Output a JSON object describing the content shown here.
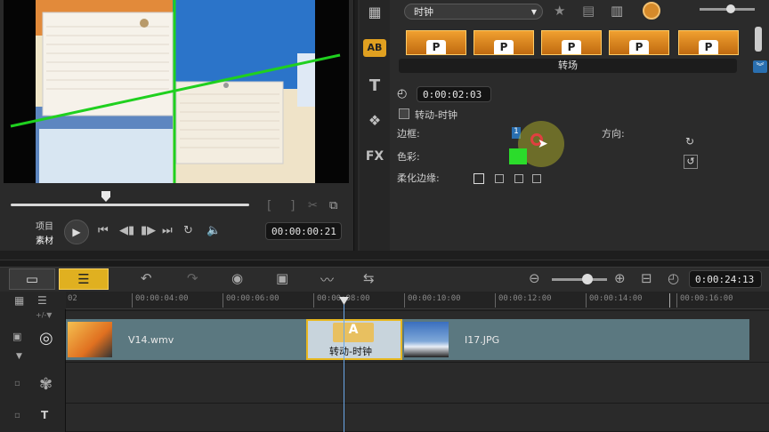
{
  "preview": {
    "mode_project": "项目",
    "mode_clip": "素材",
    "timecode": "00:00:00:21",
    "mark_in": "[",
    "mark_out": "]"
  },
  "options": {
    "dropdown_value": "时钟",
    "duration": "0:00:02:03",
    "transition_name": "转动-时钟",
    "title_bar": "转场",
    "border_label": "边框:",
    "border_value": "1",
    "direction_label": "方向:",
    "color_label": "色彩:",
    "color_value": "#2bdc2b",
    "soft_edge_label": "柔化边缘:"
  },
  "side_tabs": [
    "media-icon",
    "AB",
    "T",
    "filter-icon",
    "FX"
  ],
  "toolbar": {
    "timecode": "0:00:24:13"
  },
  "ruler": {
    "ticks": [
      "00:00:04:00",
      "00:00:06:00",
      "00:00:08:00",
      "00:00:10:00",
      "00:00:12:00",
      "00:00:14:00",
      "00:00:16:00"
    ],
    "start": "02"
  },
  "timeline": {
    "clip1_name": "V14.wmv",
    "transition_label": "转动-时钟",
    "clip2_name": "I17.JPG"
  }
}
